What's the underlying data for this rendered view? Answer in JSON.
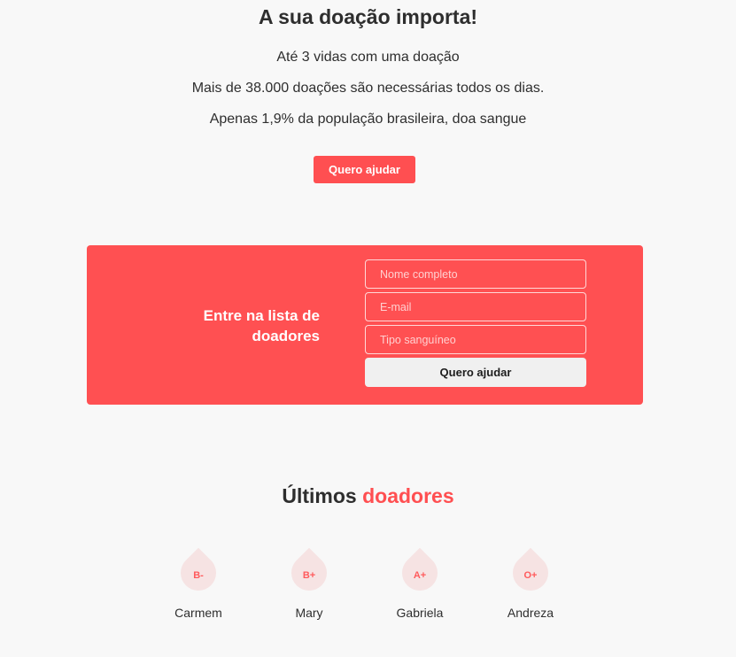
{
  "hero": {
    "title": "A sua doação importa!",
    "lines": [
      "Até 3 vidas com uma doação",
      "Mais de 38.000 doações são necessárias todos os dias.",
      "Apenas 1,9% da população brasileira, doa sangue"
    ],
    "button_label": "Quero ajudar"
  },
  "signup": {
    "title": "Entre na lista de doadores",
    "fields": {
      "name_placeholder": "Nome completo",
      "email_placeholder": "E-mail",
      "blood_type_placeholder": "Tipo sanguíneo"
    },
    "submit_label": "Quero ajudar"
  },
  "donors": {
    "title_prefix": "Últimos",
    "title_accent": "doadores",
    "items": [
      {
        "blood_type": "B-",
        "name": "Carmem",
        "icon": "blood-drop-icon"
      },
      {
        "blood_type": "B+",
        "name": "Mary",
        "icon": "blood-drop-icon"
      },
      {
        "blood_type": "A+",
        "name": "Gabriela",
        "icon": "blood-drop-icon"
      },
      {
        "blood_type": "O+",
        "name": "Andreza",
        "icon": "blood-drop-icon"
      }
    ]
  },
  "colors": {
    "accent": "#ff4f51",
    "background": "#f8f8f8",
    "drop": "#f6e3e3",
    "text": "#2e2e2e"
  }
}
